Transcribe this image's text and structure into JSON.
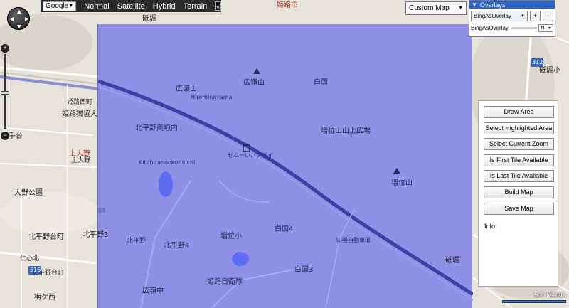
{
  "maptype_bar": {
    "provider": "Google",
    "types": [
      "Normal",
      "Satellite",
      "Hybrid",
      "Terrain"
    ],
    "collapse_glyph": "«"
  },
  "custom_map": {
    "selected": "Custom Map",
    "arrow": "▼"
  },
  "overlays": {
    "title": "Overlays",
    "selected": "BingAsOverlay",
    "add_label": "+",
    "remove_label": "-",
    "layer_name": "BingAsOverlay",
    "layer_mode": "N"
  },
  "tools": {
    "buttons": [
      "Draw Area",
      "Select Highlighted Area",
      "Select Current Zoom",
      "Is First Tile Available",
      "Is Last Tile Available",
      "Build Map",
      "Save Map"
    ],
    "info_label": "Info:"
  },
  "zoom": {
    "in_label": "+",
    "out_label": "−",
    "level_fraction": 0.48
  },
  "scale": {
    "text": "500 Meters"
  },
  "map_labels": {
    "t1": "砥堀",
    "t2": "姫路市",
    "t3": "広嶺山",
    "t4": "Hiromineyama",
    "t5": "広嶺山",
    "t6": "白国",
    "t7": "姫路獨協大",
    "t8": "北平野奥垣内",
    "t9": "増位山山上広場",
    "t10": "上大野",
    "t11": "大野公園",
    "t12": "北平野台町",
    "t13": "北平野3",
    "t14": "北平野4",
    "t15": "増位小",
    "t16": "白国4",
    "t17": "広嶺中",
    "t18": "姫路自衛隊",
    "t19": "山陽自動車道",
    "t20": "増位山",
    "t21": "北平野",
    "t22": "白国3",
    "t23": "砥堀",
    "t24": "Kitahiranookudaichi",
    "t25": "ゼムーいバヌダイ",
    "t26": "大手台",
    "t27": "北平野台町",
    "t28": "栴ケ西",
    "t29": "姫路西町",
    "t30": "312",
    "t31": "516",
    "t32": "砥堀小",
    "t33": "上大野",
    "t34": "仁心北"
  }
}
